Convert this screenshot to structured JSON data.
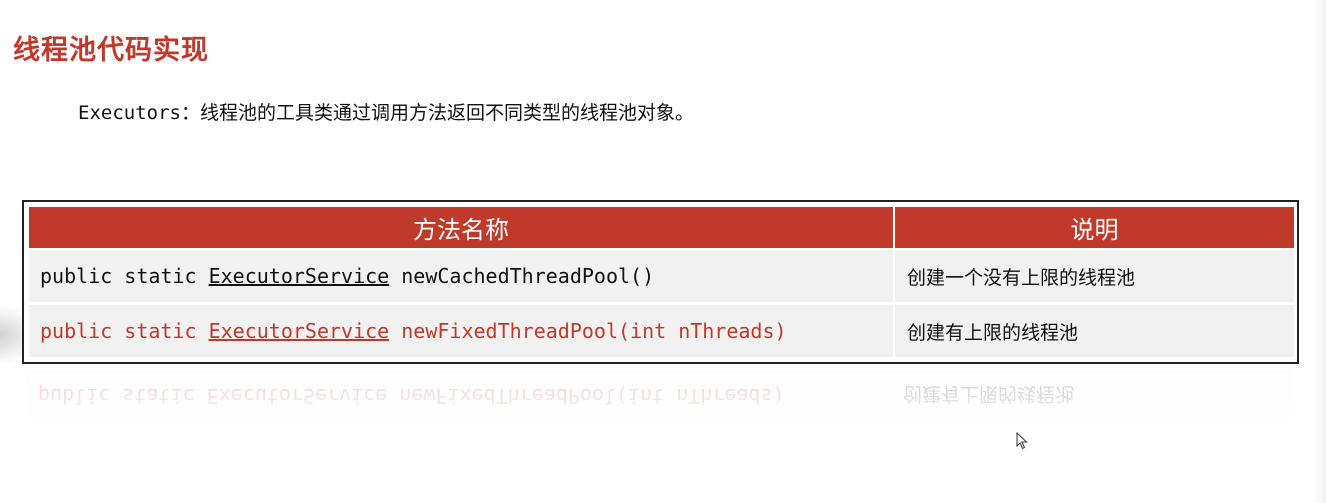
{
  "slide": {
    "title": "线程池代码实现",
    "subtitle_class": "Executors",
    "subtitle_rest": "：线程池的工具类通过调用方法返回不同类型的线程池对象。"
  },
  "table": {
    "headers": {
      "method": "方法名称",
      "description": "说明"
    },
    "rows": [
      {
        "prefix": "public static ",
        "return_type": "ExecutorService",
        "method": " newCachedThreadPool()",
        "description": "创建一个没有上限的线程池"
      },
      {
        "prefix": "public static ",
        "return_type": "ExecutorService",
        "method": " newFixedThreadPool(int nThreads)",
        "description": "创建有上限的线程池"
      }
    ]
  },
  "colors": {
    "accent": "#c0392b",
    "text": "#111111",
    "row_bg": "#f1f1f1"
  },
  "icons": {
    "cursor": "mouse-pointer-icon"
  }
}
